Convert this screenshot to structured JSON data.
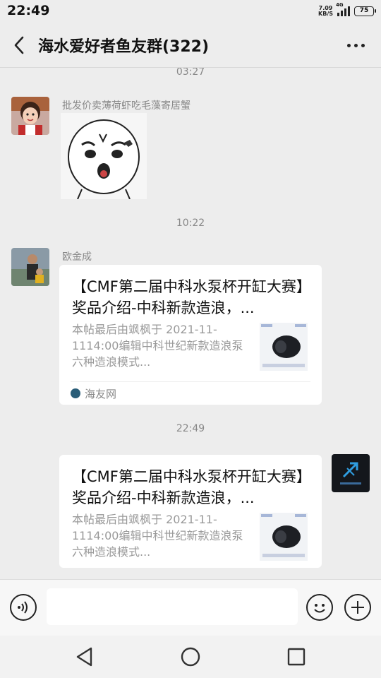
{
  "status_bar": {
    "time": "22:49",
    "net_speed_value": "7.09",
    "net_speed_unit": "KB/S",
    "network_tag": "4G",
    "battery": "75"
  },
  "header": {
    "title": "海水爱好者鱼友群(322)"
  },
  "messages": [
    {
      "timestamp": "03:27",
      "sender": "批发价卖薄荷虾吃毛藻寄居蟹",
      "type": "sticker"
    },
    {
      "timestamp": "10:22",
      "sender": "欧金成",
      "type": "link",
      "title": "【CMF第二届中科水泵杯开缸大赛】奖品介绍-中科新款造浪，...",
      "description": "本帖最后由飒枫于 2021-11-1114:00编辑中科世纪新款造浪泵六种造浪模式...",
      "source": "海友网"
    },
    {
      "timestamp": "22:49",
      "sender": "",
      "type": "link",
      "outgoing": true,
      "title": "【CMF第二届中科水泵杯开缸大赛】奖品介绍-中科新款造浪，...",
      "description": "本帖最后由飒枫于 2021-11-1114:00编辑中科世纪新款造浪泵六种造浪模式..."
    }
  ],
  "icons": {
    "back": "chevron-left-icon",
    "more": "more-dots-icon",
    "voice": "voice-icon",
    "emoji": "emoji-icon",
    "plus": "plus-icon",
    "nav_back": "triangle-back-icon",
    "nav_home": "circle-home-icon",
    "nav_recent": "square-recent-icon"
  },
  "colors": {
    "background": "#ededed",
    "bubble": "#ffffff"
  }
}
